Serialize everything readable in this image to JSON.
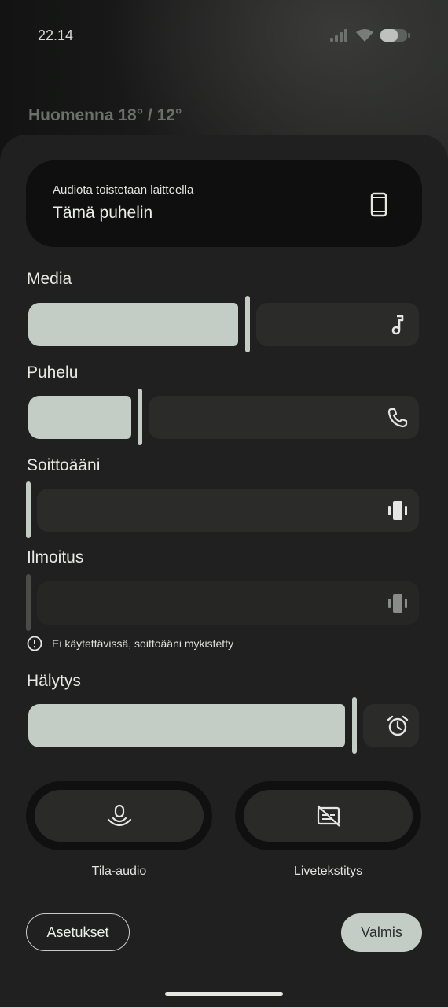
{
  "status_bar": {
    "time": "22.14",
    "icons": [
      "signal-icon",
      "wifi-icon",
      "battery-icon"
    ]
  },
  "weather": {
    "text": "Huomenna 18° / 12°"
  },
  "output": {
    "label": "Audiota toistetaan laitteella",
    "device": "Tämä puhelin",
    "icon": "phone-device-icon"
  },
  "sliders": [
    {
      "id": "media",
      "label": "Media",
      "level": 0.54,
      "icon": "music-note-icon"
    },
    {
      "id": "call",
      "label": "Puhelu",
      "level": 0.27,
      "icon": "phone-icon"
    },
    {
      "id": "ring",
      "label": "Soittoääni",
      "level": 0.0,
      "icon": "vibrate-icon"
    },
    {
      "id": "notification",
      "label": "Ilmoitus",
      "level": 0.0,
      "icon": "vibrate-icon",
      "disabled": true
    },
    {
      "id": "alarm",
      "label": "Hälytys",
      "level": 0.82,
      "icon": "alarm-icon"
    }
  ],
  "notification_note": "Ei käytettävissä, soittoääni mykistetty",
  "toggles": [
    {
      "label": "Tila-audio",
      "icon": "spatial-audio-icon"
    },
    {
      "label": "Livetekstitys",
      "icon": "live-caption-off-icon"
    }
  ],
  "buttons": {
    "settings": "Asetukset",
    "done": "Valmis"
  },
  "colors": {
    "accent": "#c4cdc5",
    "track": "#2b2c2a",
    "panel": "#1f201f"
  }
}
